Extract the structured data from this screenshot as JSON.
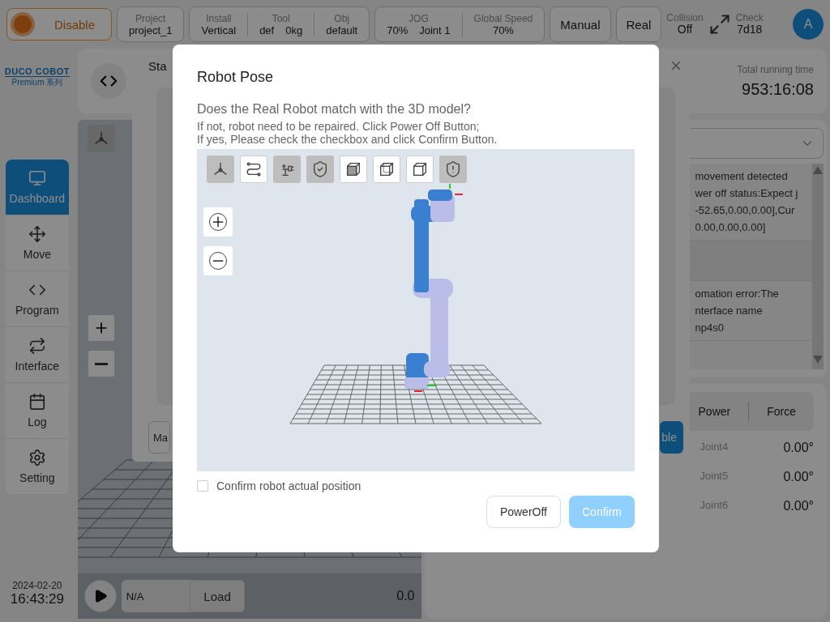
{
  "top_bar": {
    "power_button": {
      "label": "Disable"
    },
    "groups": [
      {
        "items": [
          {
            "label": "Project",
            "values": [
              "project_1"
            ]
          }
        ]
      },
      {
        "items": [
          {
            "label": "Install",
            "values": [
              "Vertical"
            ]
          },
          {
            "label": "Tool",
            "values": [
              "def",
              "0kg"
            ]
          },
          {
            "label": "Obj",
            "values": [
              "default"
            ]
          }
        ]
      },
      {
        "items": [
          {
            "label": "JOG",
            "values": [
              "70%",
              "Joint 1"
            ]
          },
          {
            "label": "Global Speed",
            "values": [
              "70%"
            ]
          }
        ]
      }
    ],
    "mode_buttons": [
      "Manual",
      "Real"
    ],
    "collision": {
      "label": "Collision",
      "value": "Off"
    },
    "check": {
      "label": "Check",
      "value": "7d18"
    },
    "avatar": "A"
  },
  "sidebar": {
    "logo": {
      "brand": "DUCO COBOT",
      "edition": "Premium 系列"
    },
    "items": [
      {
        "label": "Dashboard",
        "selected": true
      },
      {
        "label": "Move",
        "selected": false
      },
      {
        "label": "Program",
        "selected": false
      },
      {
        "label": "Interface",
        "selected": false
      },
      {
        "label": "Log",
        "selected": false
      },
      {
        "label": "Setting",
        "selected": false
      }
    ],
    "date": "2024-02-20",
    "time": "16:43:29"
  },
  "player": {
    "program": "N/A",
    "load_button": "Load",
    "speed": "0.0"
  },
  "status": {
    "running_time_label": "Total running time",
    "running_time": "953:16:08",
    "log": [
      {
        "kind": "text",
        "lines": [
          "movement detected",
          "wer off status:Expect j",
          "-52.65,0.00,0.00],Cur",
          "0.00,0.00,0.00]"
        ]
      },
      {
        "kind": "blank"
      },
      {
        "kind": "text",
        "lines": [
          "omation error:The",
          "nterface name",
          "np4s0"
        ]
      }
    ],
    "tabs": [
      {
        "label": "Power",
        "selected": false
      },
      {
        "label": "Force",
        "selected": false
      }
    ],
    "joints": [
      {
        "label": "Joint4",
        "value": "0.00°"
      },
      {
        "label": "Joint5",
        "value": "0.00°"
      },
      {
        "label": "Joint6",
        "value": "0.00°"
      }
    ]
  },
  "back_dialog": {
    "title": "Sta",
    "left_button": "Ma",
    "right_button": "ble"
  },
  "dialog": {
    "title": "Robot Pose",
    "question": "Does the Real Robot match with the 3D model?",
    "lines": [
      "If not, robot need to be repaired. Click Power Off Button;",
      "If yes, Please check the checkbox and click Confirm Button."
    ],
    "toolbar": [
      {
        "selected": true
      },
      {
        "selected": false
      },
      {
        "selected": true
      },
      {
        "selected": true
      },
      {
        "selected": false
      },
      {
        "selected": false
      },
      {
        "selected": false
      },
      {
        "selected": true
      }
    ],
    "checkbox": {
      "label": "Confirm robot actual position",
      "checked": false
    },
    "buttons": [
      {
        "label": "PowerOff",
        "kind": "plain",
        "disabled": false
      },
      {
        "label": "Confirm",
        "kind": "primary",
        "disabled": true
      }
    ]
  }
}
